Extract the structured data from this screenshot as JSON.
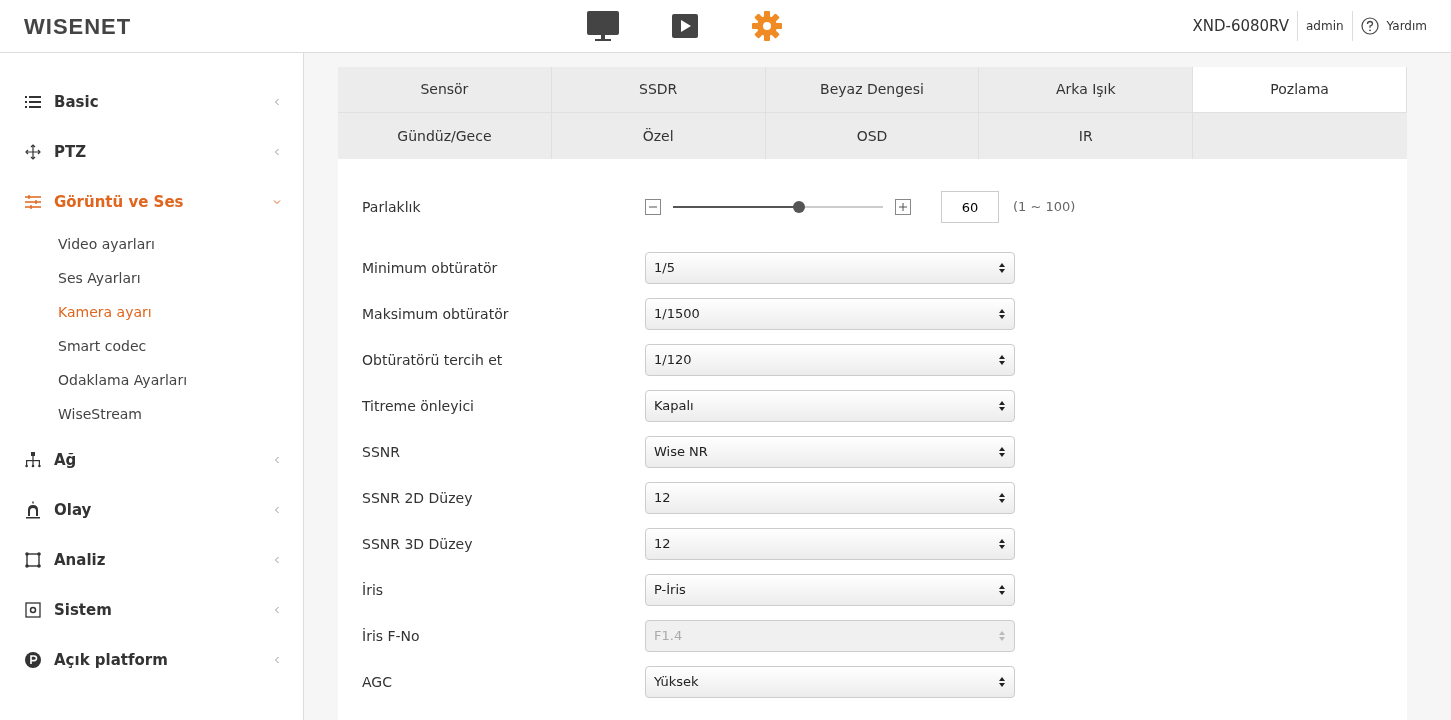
{
  "header": {
    "logo": "WISENET",
    "nav": [
      {
        "selected": false
      },
      {
        "selected": false
      },
      {
        "selected": true
      }
    ],
    "model": "XND-6080RV",
    "user": "admin",
    "help": "Yardım"
  },
  "sidebar": {
    "items": [
      {
        "label": "Basic",
        "expanded": false,
        "selected": false
      },
      {
        "label": "PTZ",
        "expanded": false,
        "selected": false
      },
      {
        "label": "Görüntü ve Ses",
        "expanded": true,
        "selected": true,
        "children": [
          {
            "label": "Video ayarları",
            "selected": false
          },
          {
            "label": "Ses Ayarları",
            "selected": false
          },
          {
            "label": "Kamera ayarı",
            "selected": true
          },
          {
            "label": "Smart codec",
            "selected": false
          },
          {
            "label": "Odaklama Ayarları",
            "selected": false
          },
          {
            "label": "WiseStream",
            "selected": false
          }
        ]
      },
      {
        "label": "Ağ",
        "expanded": false,
        "selected": false
      },
      {
        "label": "Olay",
        "expanded": false,
        "selected": false
      },
      {
        "label": "Analiz",
        "expanded": false,
        "selected": false
      },
      {
        "label": "Sistem",
        "expanded": false,
        "selected": false
      },
      {
        "label": "Açık platform",
        "expanded": false,
        "selected": false
      }
    ]
  },
  "tabs": [
    {
      "label": "Sensör",
      "selected": false
    },
    {
      "label": "SSDR",
      "selected": false
    },
    {
      "label": "Beyaz Dengesi",
      "selected": false
    },
    {
      "label": "Arka Işık",
      "selected": false
    },
    {
      "label": "Pozlama",
      "selected": true
    },
    {
      "label": "Gündüz/Gece",
      "selected": false
    },
    {
      "label": "Özel",
      "selected": false
    },
    {
      "label": "OSD",
      "selected": false
    },
    {
      "label": "IR",
      "selected": false
    }
  ],
  "settings": [
    {
      "kind": "slider",
      "label": "Parlaklık",
      "level": 0.6,
      "value": "60",
      "range": "(1 ~ 100)"
    },
    {
      "kind": "select",
      "label": "Minimum obtüratör",
      "value": "1/5",
      "disabled": false
    },
    {
      "kind": "select",
      "label": "Maksimum obtüratör",
      "value": "1/1500",
      "disabled": false
    },
    {
      "kind": "select",
      "label": "Obtüratörü tercih et",
      "value": "1/120",
      "disabled": false
    },
    {
      "kind": "select",
      "label": "Titreme önleyici",
      "value": "Kapalı",
      "disabled": false
    },
    {
      "kind": "select",
      "label": "SSNR",
      "value": "Wise NR",
      "disabled": false
    },
    {
      "kind": "select",
      "label": "SSNR 2D Düzey",
      "value": "12",
      "disabled": false
    },
    {
      "kind": "select",
      "label": "SSNR 3D Düzey",
      "value": "12",
      "disabled": false
    },
    {
      "kind": "select",
      "label": "İris",
      "value": "P-İris",
      "disabled": false
    },
    {
      "kind": "select",
      "label": "İris F-No",
      "value": "F1.4",
      "disabled": true
    },
    {
      "kind": "select",
      "label": "AGC",
      "value": "Yüksek",
      "disabled": false
    }
  ]
}
